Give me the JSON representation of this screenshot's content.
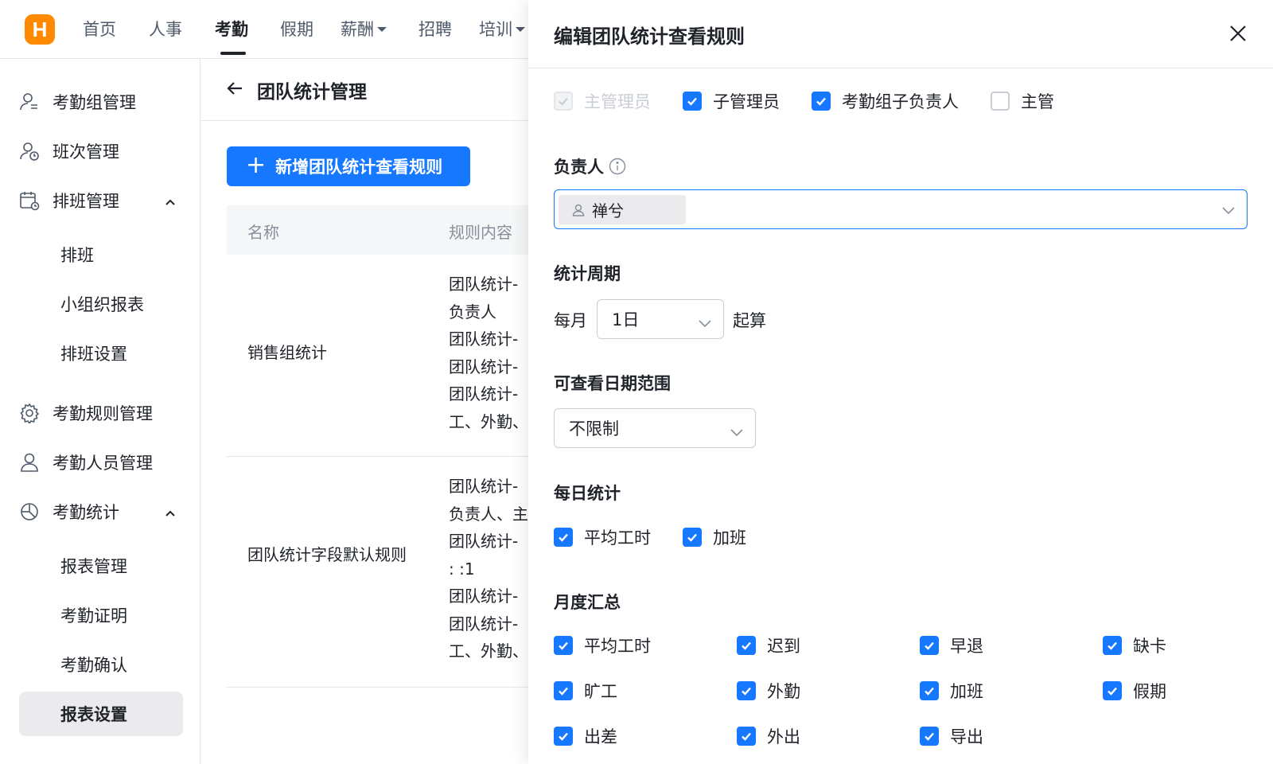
{
  "topnav": {
    "logo_text": "H",
    "items": [
      "首页",
      "人事",
      "考勤",
      "假期",
      "薪酬",
      "招聘",
      "培训"
    ],
    "active_index": 2
  },
  "sidebar": {
    "groups": [
      {
        "label": "考勤组管理",
        "icon": "user-group-icon"
      },
      {
        "label": "班次管理",
        "icon": "shift-icon"
      },
      {
        "label": "排班管理",
        "icon": "calendar-icon",
        "expanded": true,
        "children": [
          "排班",
          "小组织报表",
          "排班设置"
        ]
      },
      {
        "label": "考勤规则管理",
        "icon": "gear-icon"
      },
      {
        "label": "考勤人员管理",
        "icon": "user-icon"
      },
      {
        "label": "考勤统计",
        "icon": "pie-chart-icon",
        "expanded": true,
        "children": [
          "报表管理",
          "考勤证明",
          "考勤确认",
          "报表设置"
        ]
      }
    ],
    "active_child": "报表设置"
  },
  "main": {
    "title": "团队统计管理",
    "add_button": "新增团队统计查看规则",
    "columns": [
      "名称",
      "规则内容"
    ],
    "rows": [
      {
        "name": "销售组统计",
        "rule_lines": [
          "团队统计-",
          "负责人",
          "团队统计-",
          "团队统计-",
          "团队统计-",
          "工、外勤、"
        ]
      },
      {
        "name": "团队统计字段默认规则",
        "rule_lines": [
          "团队统计-",
          "负责人、主",
          "团队统计-",
          ": :1",
          "团队统计-",
          "团队统计-",
          "工、外勤、"
        ]
      }
    ]
  },
  "drawer": {
    "title": "编辑团队统计查看规则",
    "roles": [
      {
        "label": "主管理员",
        "checked": true,
        "disabled": true
      },
      {
        "label": "子管理员",
        "checked": true,
        "disabled": false
      },
      {
        "label": "考勤组子负责人",
        "checked": true,
        "disabled": false
      },
      {
        "label": "主管",
        "checked": false,
        "disabled": false
      }
    ],
    "owner_label": "负责人",
    "owner_tag": "禅兮",
    "period_label": "统计周期",
    "period_prefix": "每月",
    "period_value": "1日",
    "period_suffix": "起算",
    "range_label": "可查看日期范围",
    "range_value": "不限制",
    "daily_label": "每日统计",
    "daily_items": [
      {
        "label": "平均工时",
        "checked": true
      },
      {
        "label": "加班",
        "checked": true
      }
    ],
    "monthly_label": "月度汇总",
    "monthly_items": [
      {
        "label": "平均工时",
        "checked": true
      },
      {
        "label": "迟到",
        "checked": true
      },
      {
        "label": "早退",
        "checked": true
      },
      {
        "label": "缺卡",
        "checked": true
      },
      {
        "label": "旷工",
        "checked": true
      },
      {
        "label": "外勤",
        "checked": true
      },
      {
        "label": "加班",
        "checked": true
      },
      {
        "label": "假期",
        "checked": true
      },
      {
        "label": "出差",
        "checked": true
      },
      {
        "label": "外出",
        "checked": true
      },
      {
        "label": "导出",
        "checked": true
      }
    ]
  },
  "colors": {
    "primary": "#1677ff",
    "logo": "#ff8a00",
    "text": "#1f2329",
    "muted": "#86909c"
  }
}
